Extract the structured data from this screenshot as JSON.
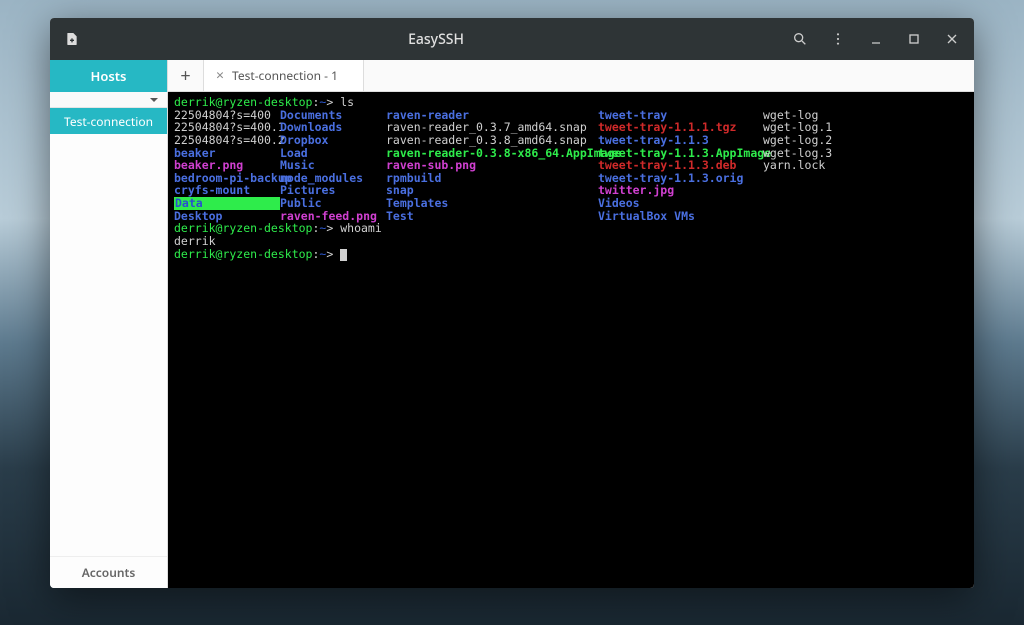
{
  "window": {
    "title": "EasySSH"
  },
  "titlebar": {
    "new_icon": "new-file-icon",
    "search_icon": "search-icon",
    "menu_icon": "kebab-menu-icon",
    "minimize_icon": "minimize-icon",
    "maximize_icon": "maximize-icon",
    "close_icon": "close-icon"
  },
  "sidebar": {
    "header": "Hosts",
    "items": [
      {
        "label": "Test-connection"
      }
    ],
    "footer": "Accounts"
  },
  "tabs": {
    "add_label": "+",
    "items": [
      {
        "label": "Test-connection - 1",
        "close": "×"
      }
    ]
  },
  "terminal": {
    "prompt_user": "derrik@ryzen-desktop",
    "prompt_sep": ":",
    "prompt_tilde": "~",
    "prompt_end": ">",
    "cmd_ls": "ls",
    "cmd_whoami": "whoami",
    "whoami_output": "derrik",
    "ls": {
      "col0": [
        {
          "t": "22504804?s=400",
          "c": "c-white"
        },
        {
          "t": "22504804?s=400.1",
          "c": "c-white"
        },
        {
          "t": "22504804?s=400.2",
          "c": "c-white"
        },
        {
          "t": "beaker",
          "c": "c-blue"
        },
        {
          "t": "beaker.png",
          "c": "c-mag"
        },
        {
          "t": "bedroom-pi-backup",
          "c": "c-blue"
        },
        {
          "t": "cryfs-mount",
          "c": "c-blue"
        },
        {
          "t": "Data",
          "c": "c-greenbg"
        },
        {
          "t": "Desktop",
          "c": "c-blue"
        }
      ],
      "col1": [
        {
          "t": "Documents",
          "c": "c-blue"
        },
        {
          "t": "Downloads",
          "c": "c-blue"
        },
        {
          "t": "Dropbox",
          "c": "c-blue"
        },
        {
          "t": "Load",
          "c": "c-blue"
        },
        {
          "t": "Music",
          "c": "c-blue"
        },
        {
          "t": "node_modules",
          "c": "c-blue"
        },
        {
          "t": "Pictures",
          "c": "c-blue"
        },
        {
          "t": "Public",
          "c": "c-blue"
        },
        {
          "t": "raven-feed.png",
          "c": "c-mag"
        }
      ],
      "col2": [
        {
          "t": "raven-reader",
          "c": "c-blue"
        },
        {
          "t": "raven-reader_0.3.7_amd64.snap",
          "c": "c-white"
        },
        {
          "t": "raven-reader_0.3.8_amd64.snap",
          "c": "c-white"
        },
        {
          "t": "raven-reader-0.3.8-x86_64.AppImage",
          "c": "c-green"
        },
        {
          "t": "raven-sub.png",
          "c": "c-mag"
        },
        {
          "t": "rpmbuild",
          "c": "c-blue"
        },
        {
          "t": "snap",
          "c": "c-blue"
        },
        {
          "t": "Templates",
          "c": "c-blue"
        },
        {
          "t": "Test",
          "c": "c-blue"
        }
      ],
      "col3": [
        {
          "t": "tweet-tray",
          "c": "c-blue"
        },
        {
          "t": "tweet-tray-1.1.1.tgz",
          "c": "c-red"
        },
        {
          "t": "tweet-tray-1.1.3",
          "c": "c-blue"
        },
        {
          "t": "tweet-tray-1.1.3.AppImage",
          "c": "c-green"
        },
        {
          "t": "tweet-tray-1.1.3.deb",
          "c": "c-red"
        },
        {
          "t": "tweet-tray-1.1.3.orig",
          "c": "c-blue"
        },
        {
          "t": "twitter.jpg",
          "c": "c-mag"
        },
        {
          "t": "Videos",
          "c": "c-blue"
        },
        {
          "t": "VirtualBox VMs",
          "c": "c-blue"
        }
      ],
      "col4": [
        {
          "t": "wget-log",
          "c": "c-white"
        },
        {
          "t": "wget-log.1",
          "c": "c-white"
        },
        {
          "t": "wget-log.2",
          "c": "c-white"
        },
        {
          "t": "wget-log.3",
          "c": "c-white"
        },
        {
          "t": "yarn.lock",
          "c": "c-white"
        }
      ]
    }
  }
}
